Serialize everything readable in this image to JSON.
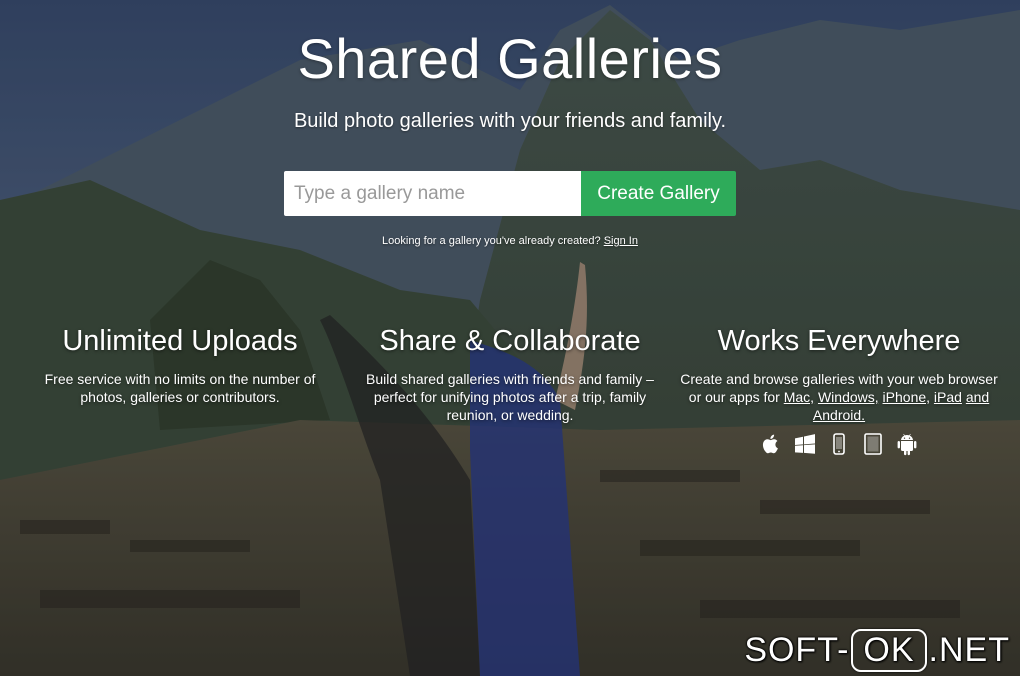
{
  "hero": {
    "title": "Shared Galleries",
    "subtitle": "Build photo galleries with your friends and family."
  },
  "form": {
    "input_placeholder": "Type a gallery name",
    "input_value": "",
    "create_label": "Create Gallery"
  },
  "signin": {
    "prompt": "Looking for a gallery you've already created?",
    "link_label": "Sign In"
  },
  "features": [
    {
      "title": "Unlimited Uploads",
      "description": "Free service with no limits on the number of photos, galleries or contributors."
    },
    {
      "title": "Share & Collaborate",
      "description": "Build shared galleries with friends and family – perfect for unifying photos after a trip, family reunion, or wedding."
    },
    {
      "title": "Works Everywhere",
      "description_prefix": "Create and browse galleries with your web browser or our apps for",
      "links": [
        "Mac,",
        "Windows,",
        "iPhone,",
        "iPad",
        "and",
        "Android."
      ],
      "platform_icons": [
        "apple-icon",
        "windows-icon",
        "iphone-icon",
        "ipad-icon",
        "android-icon"
      ]
    }
  ],
  "watermark": {
    "left": "SOFT-",
    "box": "OK",
    "right": ".NET"
  },
  "colors": {
    "create_button": "#2eab5a",
    "text": "#ffffff"
  }
}
